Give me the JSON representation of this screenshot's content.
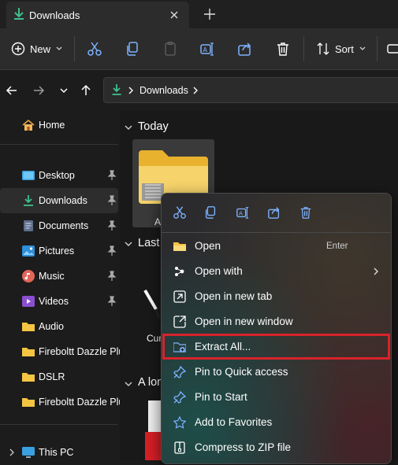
{
  "titlebar": {
    "tab_title": "Downloads"
  },
  "toolbar": {
    "new_label": "New",
    "sort_label": "Sort"
  },
  "address": {
    "crumbs": [
      "Downloads"
    ]
  },
  "sidebar": {
    "home": "Home",
    "items": [
      {
        "label": "Desktop",
        "pinned": true
      },
      {
        "label": "Downloads",
        "pinned": true,
        "selected": true
      },
      {
        "label": "Documents",
        "pinned": true
      },
      {
        "label": "Pictures",
        "pinned": true
      },
      {
        "label": "Music",
        "pinned": true
      },
      {
        "label": "Videos",
        "pinned": true
      },
      {
        "label": "Audio",
        "pinned": false
      },
      {
        "label": "Fireboltt Dazzle Plu",
        "pinned": false
      },
      {
        "label": "DSLR",
        "pinned": false
      },
      {
        "label": "Fireboltt Dazzle Plu",
        "pinned": false
      }
    ],
    "this_pc": "This PC"
  },
  "content": {
    "groups": [
      "Today",
      "Last",
      "A lon"
    ],
    "file_label_1": "A",
    "file_label_2": "Cur"
  },
  "context_menu": {
    "items": [
      {
        "label": "Open",
        "shortcut": "Enter"
      },
      {
        "label": "Open with"
      },
      {
        "label": "Open in new tab"
      },
      {
        "label": "Open in new window"
      },
      {
        "label": "Extract All..."
      },
      {
        "label": "Pin to Quick access"
      },
      {
        "label": "Pin to Start"
      },
      {
        "label": "Add to Favorites"
      },
      {
        "label": "Compress to ZIP file"
      }
    ]
  },
  "colors": {
    "accent_green": "#3fbf8f",
    "folder_yellow": "#f4c542",
    "highlight_red": "#d8232b"
  }
}
